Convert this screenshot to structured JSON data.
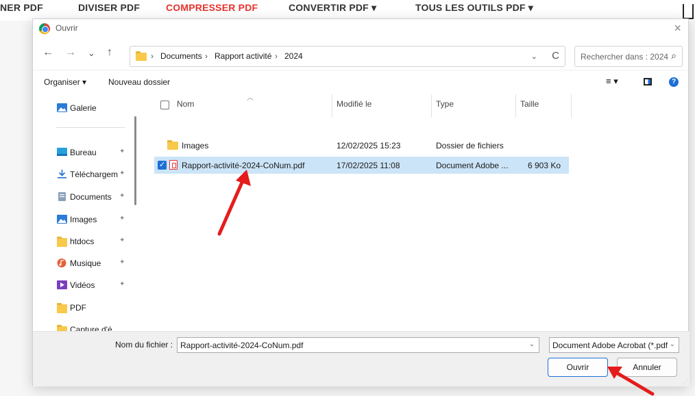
{
  "background_nav": {
    "items": [
      {
        "label": "NER PDF",
        "active": false
      },
      {
        "label": "DIVISER PDF",
        "active": false
      },
      {
        "label": "COMPRESSER PDF",
        "active": true
      },
      {
        "label": "CONVERTIR PDF ▾",
        "active": false
      },
      {
        "label": "TOUS LES OUTILS PDF ▾",
        "active": false
      }
    ],
    "active_color": "#e5322d"
  },
  "dialog": {
    "title": "Ouvrir",
    "close_icon": "×",
    "nav": {
      "back": "←",
      "forward": "→",
      "recent": "⌄",
      "up": "↑"
    },
    "address": {
      "crumbs": [
        "Documents",
        "Rapport activité",
        "2024"
      ],
      "separator": "›",
      "dropdown": "⌄",
      "refresh": "C"
    },
    "search": {
      "placeholder": "Rechercher dans : 2024",
      "icon": "⌕"
    },
    "toolbar": {
      "organize": "Organiser ▾",
      "new_folder": "Nouveau dossier",
      "view_icon": "≡ ▾",
      "help": "?"
    },
    "sidebar": {
      "items": [
        {
          "label": "Galerie",
          "icon": "gallery-icon",
          "pinned": false
        },
        {
          "label": "Bureau",
          "icon": "desktop-icon",
          "pinned": true
        },
        {
          "label": "Téléchargem",
          "icon": "download-icon",
          "pinned": true
        },
        {
          "label": "Documents",
          "icon": "document-icon",
          "pinned": true
        },
        {
          "label": "Images",
          "icon": "image-icon",
          "pinned": true
        },
        {
          "label": "htdocs",
          "icon": "folder-icon",
          "pinned": true
        },
        {
          "label": "Musique",
          "icon": "music-icon",
          "pinned": true
        },
        {
          "label": "Vidéos",
          "icon": "video-icon",
          "pinned": true
        },
        {
          "label": "PDF",
          "icon": "folder-icon",
          "pinned": false
        },
        {
          "label": "Capture d'é",
          "icon": "folder-icon",
          "pinned": false
        }
      ],
      "pin_glyph": "📌"
    },
    "columns": {
      "name": "Nom",
      "modified": "Modifié le",
      "type": "Type",
      "size": "Taille"
    },
    "files": [
      {
        "name": "Images",
        "modified": "12/02/2025 15:23",
        "type": "Dossier de fichiers",
        "size": "",
        "kind": "folder",
        "selected": false
      },
      {
        "name": "Rapport-activité-2024-CoNum.pdf",
        "modified": "17/02/2025 11:08",
        "type": "Document Adobe ...",
        "size": "6 903 Ko",
        "kind": "pdf",
        "selected": true
      }
    ],
    "bottom": {
      "filename_label": "Nom du fichier :",
      "filename_value": "Rapport-activité-2024-CoNum.pdf",
      "filetype_value": "Document Adobe Acrobat (*.pdf)",
      "open_label": "Ouvrir",
      "cancel_label": "Annuler"
    }
  }
}
